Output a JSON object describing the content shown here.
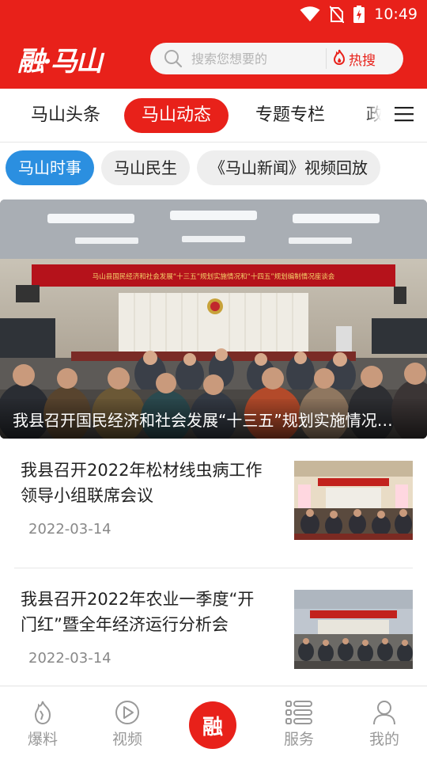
{
  "status_bar": {
    "time": "10:49"
  },
  "header": {
    "logo_text": "融·马山",
    "search_placeholder": "搜索您想要的",
    "hot_label": "热搜"
  },
  "tabs": [
    {
      "label": "马山头条"
    },
    {
      "label": "马山动态",
      "active": true
    },
    {
      "label": "专题专栏"
    },
    {
      "label": "政"
    }
  ],
  "subtabs": [
    {
      "label": "马山时事",
      "active": true
    },
    {
      "label": "马山民生"
    },
    {
      "label": "《马山新闻》视频回放"
    }
  ],
  "hero": {
    "banner_text": "马山县国民经济和社会发展“十三五”规划实施情况和“十四五”规划编制情况座谈会",
    "caption": "我县召开国民经济和社会发展“十三五”规划实施情况和“十四五”规划编制情况座谈会"
  },
  "news": [
    {
      "title": "我县召开2022年松材线虫病工作领导小组联席会议",
      "date": "2022-03-14"
    },
    {
      "title": "我县召开2022年农业一季度“开门红”暨全年经济运行分析会",
      "date": "2022-03-14"
    }
  ],
  "bottom_nav": {
    "items": [
      {
        "label": "爆料"
      },
      {
        "label": "视频"
      },
      {
        "label": "服务"
      },
      {
        "label": "我的"
      }
    ],
    "center_label": "融"
  },
  "colors": {
    "brand_red": "#e8211a",
    "chip_blue": "#2b8fe0"
  }
}
